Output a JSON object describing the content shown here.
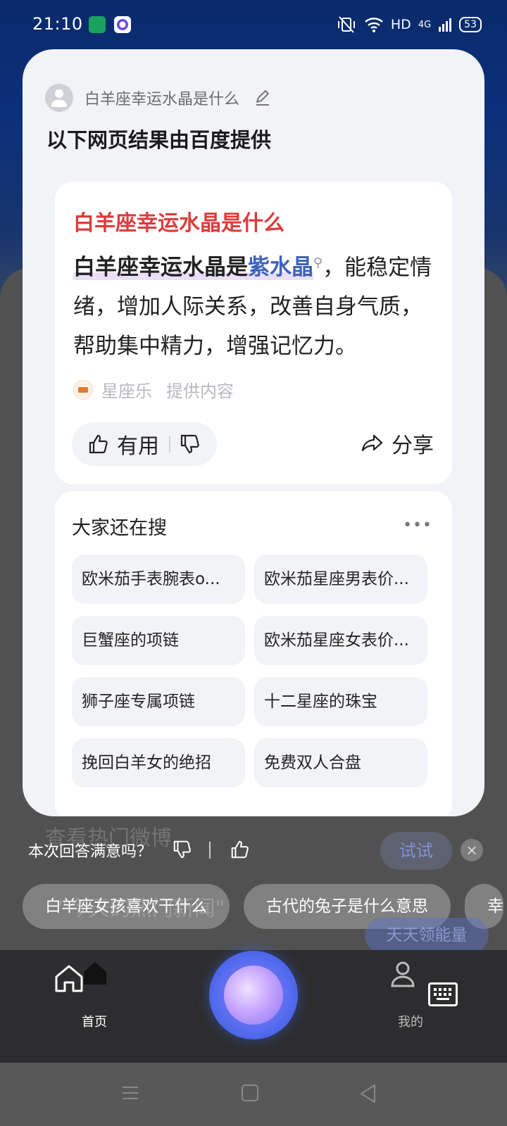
{
  "status_bar": {
    "time": "21:10",
    "network": "HD",
    "signal": "4G",
    "battery": "53"
  },
  "background": {
    "text1": "查看热门微博",
    "text2": "\"今天的热门新闻\""
  },
  "query": {
    "text": "白羊座幸运水晶是什么"
  },
  "provider_title": "以下网页结果由百度提供",
  "answer": {
    "title": "白羊座幸运水晶是什么",
    "highlight_prefix": "白羊座幸运水晶是",
    "highlight_term": "紫水晶",
    "body_rest": "，能稳定情绪，增加人际关系，改善自身气质，帮助集中精力，增强记忆力。",
    "source_name": "星座乐",
    "source_suffix": "提供内容",
    "useful_label": "有用",
    "share_label": "分享"
  },
  "related": {
    "title": "大家还在搜",
    "more": "•••",
    "items": [
      "欧米茄手表腕表o...",
      "欧米茄星座男表价...",
      "巨蟹座的项链",
      "欧米茄星座女表价...",
      "狮子座专属项链",
      "十二星座的珠宝",
      "挽回白羊女的绝招",
      "免费双人合盘"
    ]
  },
  "feedback_bar": {
    "question": "本次回答满意吗？",
    "try_label": "试试",
    "close": "×"
  },
  "suggestions": [
    "白羊座女孩喜欢干什么",
    "古代的兔子是什么意思",
    "幸"
  ],
  "energy_label": "天天领能量",
  "bottom_nav": {
    "home_label": "首页",
    "me_label": "我的"
  },
  "colors": {
    "answer_title": "#dd3b3b",
    "highlight_term": "#3d63b8",
    "assistant_orb": "#5a6ef0"
  }
}
